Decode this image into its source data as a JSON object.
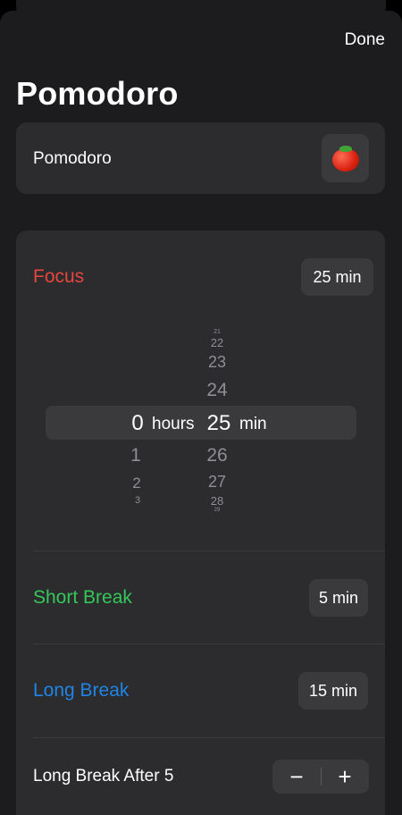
{
  "header": {
    "done_label": "Done",
    "title": "Pomodoro"
  },
  "name_card": {
    "name": "Pomodoro",
    "emoji_icon": "tomato-icon"
  },
  "focus": {
    "label": "Focus",
    "value": "25 min",
    "color": "#e5473f",
    "picker": {
      "hours_above": [],
      "hours_selected": "0",
      "hours_unit": "hours",
      "hours_below": [
        "1",
        "2",
        "3"
      ],
      "minutes_above": [
        "21",
        "22",
        "23",
        "24"
      ],
      "minutes_selected": "25",
      "minutes_unit": "min",
      "minutes_below": [
        "26",
        "27",
        "28",
        "29"
      ]
    }
  },
  "short_break": {
    "label": "Short Break",
    "value": "5 min",
    "color": "#34c759"
  },
  "long_break": {
    "label": "Long Break",
    "value": "15 min",
    "color": "#1f85e6"
  },
  "long_break_after": {
    "label": "Long Break After 5",
    "minus": "−",
    "plus": "+"
  },
  "colors": {
    "background": "#1c1c1e",
    "card": "#2c2c2e",
    "control": "#3a3a3c"
  }
}
